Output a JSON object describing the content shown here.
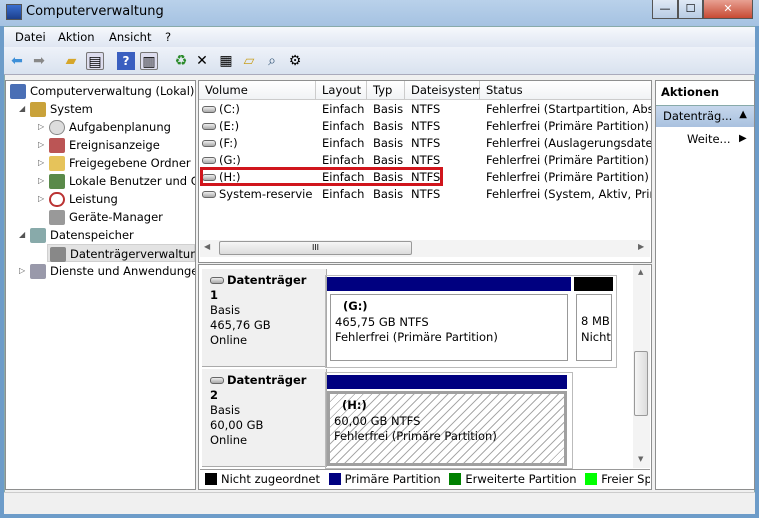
{
  "window": {
    "title": "Computerverwaltung",
    "minimize": "—",
    "maximize": "☐",
    "close": "✕"
  },
  "menu": [
    "Datei",
    "Aktion",
    "Ansicht",
    "?"
  ],
  "toolbar": {
    "icons": [
      "back-arrow-icon",
      "forward-arrow-icon",
      "up-folder-icon",
      "show-hide-tree-icon",
      "help-icon",
      "show-hide-action-icon",
      "refresh-icon",
      "delete-icon",
      "properties-icon",
      "open-icon",
      "search-icon",
      "settings-icon"
    ]
  },
  "tree": {
    "root": "Computerverwaltung (Lokal)",
    "system": "System",
    "items": [
      "Aufgabenplanung",
      "Ereignisanzeige",
      "Freigegebene Ordner",
      "Lokale Benutzer und Gruppen",
      "Leistung",
      "Geräte-Manager"
    ],
    "storage": "Datenspeicher",
    "disk_mgmt": "Datenträgerverwaltung",
    "services": "Dienste und Anwendungen"
  },
  "volumes": {
    "columns": [
      "Volume",
      "Layout",
      "Typ",
      "Dateisystem",
      "Status"
    ],
    "rows": [
      [
        "(C:)",
        "Einfach",
        "Basis",
        "NTFS",
        "Fehlerfrei (Startpartition, Absturzabbild, Primäre Partition)"
      ],
      [
        "(E:)",
        "Einfach",
        "Basis",
        "NTFS",
        "Fehlerfrei (Primäre Partition)"
      ],
      [
        "(F:)",
        "Einfach",
        "Basis",
        "NTFS",
        "Fehlerfrei (Auslagerungsdatei, Logisches Laufwerk)"
      ],
      [
        "(G:)",
        "Einfach",
        "Basis",
        "NTFS",
        "Fehlerfrei (Primäre Partition)"
      ],
      [
        "(H:)",
        "Einfach",
        "Basis",
        "NTFS",
        "Fehlerfrei (Primäre Partition)"
      ],
      [
        "System-reserviert",
        "Einfach",
        "Basis",
        "NTFS",
        "Fehlerfrei (System, Aktiv, Primäre Partition)"
      ]
    ],
    "highlighted_row": 4,
    "scroll_grip": "III"
  },
  "disks": [
    {
      "name": "Datenträger 1",
      "type": "Basis",
      "size": "465,76 GB",
      "state": "Online",
      "partitions": [
        {
          "label": "(G:)",
          "size": "465,75 GB NTFS",
          "status": "Fehlerfrei (Primäre Partition)",
          "color": "#000080"
        },
        {
          "label": "",
          "size": "8 MB",
          "status": "Nicht zugeordnet",
          "color": "#000000"
        }
      ]
    },
    {
      "name": "Datenträger 2",
      "type": "Basis",
      "size": "60,00 GB",
      "state": "Online",
      "partitions": [
        {
          "label": "(H:)",
          "size": "60,00 GB NTFS",
          "status": "Fehlerfrei (Primäre Partition)",
          "color": "#000080",
          "selected": true
        }
      ]
    }
  ],
  "legend": [
    {
      "label": "Nicht zugeordnet",
      "color": "#000000"
    },
    {
      "label": "Primäre Partition",
      "color": "#000080"
    },
    {
      "label": "Erweiterte Partition",
      "color": "#008000"
    },
    {
      "label": "Freier Speicherplatz",
      "color": "#00ff00"
    }
  ],
  "actions": {
    "header": "Aktionen",
    "section": "Datenträg...",
    "more": "Weite..."
  }
}
